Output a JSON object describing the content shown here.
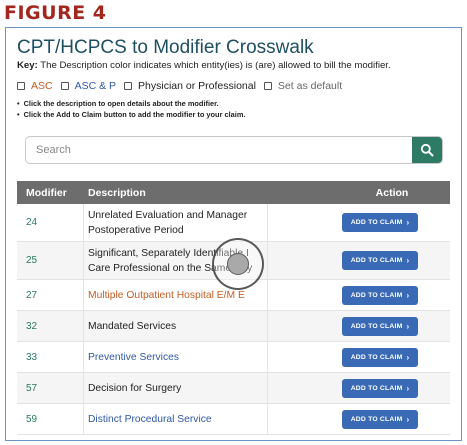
{
  "figure_label": "FIGURE 4",
  "header": {
    "title": "CPT/HCPCS to Modifier Crosswalk",
    "key_label": "Key:",
    "key_text": "The Description color indicates which entity(ies) is (are) allowed to bill the modifier."
  },
  "filters": [
    {
      "label": "ASC",
      "checked": false,
      "color": "#c25d25"
    },
    {
      "label": "ASC & P",
      "checked": false,
      "color": "#2f58a6"
    },
    {
      "label": "Physician or Professional",
      "checked": false,
      "color": "#222222"
    },
    {
      "label": "Set as default",
      "checked": false,
      "color": "#666666"
    }
  ],
  "instructions": [
    "Click the description to open details about the modifier.",
    "Click the Add to Claim button to add the modifier to your claim."
  ],
  "search": {
    "placeholder": "Search",
    "button_icon": "search-icon"
  },
  "table": {
    "columns": [
      "Modifier",
      "Description",
      "Action"
    ],
    "rows": [
      {
        "modifier": "24",
        "desc_line1": "Unrelated Evaluation and Manager",
        "desc_line2": "Postoperative Period",
        "desc_color": "dark",
        "action": "ADD TO CLAIM"
      },
      {
        "modifier": "25",
        "desc_line1": "Significant, Separately Identifiable I",
        "desc_line2": "Care Professional on the Same Day",
        "desc_color": "dark",
        "action": "ADD TO CLAIM"
      },
      {
        "modifier": "27",
        "desc_line1": "Multiple Outpatient Hospital E/M E",
        "desc_line2": "",
        "desc_color": "orange",
        "action": "ADD TO CLAIM"
      },
      {
        "modifier": "32",
        "desc_line1": "Mandated Services",
        "desc_line2": "",
        "desc_color": "dark",
        "action": "ADD TO CLAIM"
      },
      {
        "modifier": "33",
        "desc_line1": "Preventive Services",
        "desc_line2": "",
        "desc_color": "blue",
        "action": "ADD TO CLAIM"
      },
      {
        "modifier": "57",
        "desc_line1": "Decision for Surgery",
        "desc_line2": "",
        "desc_color": "dark",
        "action": "ADD TO CLAIM"
      },
      {
        "modifier": "59",
        "desc_line1": "Distinct Procedural Service",
        "desc_line2": "",
        "desc_color": "blue",
        "action": "ADD TO CLAIM"
      }
    ]
  },
  "colors": {
    "figure_label": "#a3261f",
    "title": "#1f4f63",
    "table_header": "#6d6d6d",
    "button": "#3a69b5",
    "search_button": "#2d7a65",
    "modifier_code": "#2a7a5a"
  }
}
